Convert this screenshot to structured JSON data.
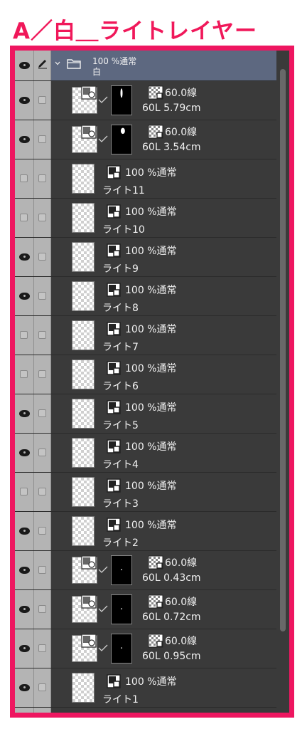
{
  "title": "A／白＿ライトレイヤー",
  "group": {
    "mode": "100 %通常",
    "name": "白"
  },
  "layers": [
    {
      "kind": "blur",
      "visible": true,
      "mode": "60.0線",
      "name": "60L 5.79cm",
      "mask": "stroke"
    },
    {
      "kind": "blur",
      "visible": true,
      "mode": "60.0線",
      "name": "60L 3.54cm",
      "mask": "blob"
    },
    {
      "kind": "raster",
      "visible": false,
      "mode": "100 %通常",
      "name": "ライト11"
    },
    {
      "kind": "raster",
      "visible": false,
      "mode": "100 %通常",
      "name": "ライト10"
    },
    {
      "kind": "raster",
      "visible": true,
      "mode": "100 %通常",
      "name": "ライト9"
    },
    {
      "kind": "raster",
      "visible": true,
      "mode": "100 %通常",
      "name": "ライト8"
    },
    {
      "kind": "raster",
      "visible": false,
      "mode": "100 %通常",
      "name": "ライト7"
    },
    {
      "kind": "raster",
      "visible": false,
      "mode": "100 %通常",
      "name": "ライト6"
    },
    {
      "kind": "raster",
      "visible": true,
      "mode": "100 %通常",
      "name": "ライト5"
    },
    {
      "kind": "raster",
      "visible": true,
      "mode": "100 %通常",
      "name": "ライト4"
    },
    {
      "kind": "raster",
      "visible": false,
      "mode": "100 %通常",
      "name": "ライト3"
    },
    {
      "kind": "raster",
      "visible": true,
      "mode": "100 %通常",
      "name": "ライト2"
    },
    {
      "kind": "blur",
      "visible": true,
      "mode": "60.0線",
      "name": "60L 0.43cm",
      "mask": "dot"
    },
    {
      "kind": "blur",
      "visible": true,
      "mode": "60.0線",
      "name": "60L 0.72cm",
      "mask": "dot"
    },
    {
      "kind": "blur",
      "visible": true,
      "mode": "60.0線",
      "name": "60L 0.95cm",
      "mask": "dot"
    },
    {
      "kind": "raster",
      "visible": true,
      "mode": "100 %通常",
      "name": "ライト1"
    }
  ],
  "colors": {
    "accent": "#ee1660",
    "panel_bg": "#3a3a3a",
    "group_bg": "#5d6880",
    "side_column": "#b4b4b4"
  },
  "icons": {
    "eye": "eye-icon",
    "pen": "pen-icon",
    "folder": "folder-icon",
    "chevron": "chevron-down-icon"
  }
}
